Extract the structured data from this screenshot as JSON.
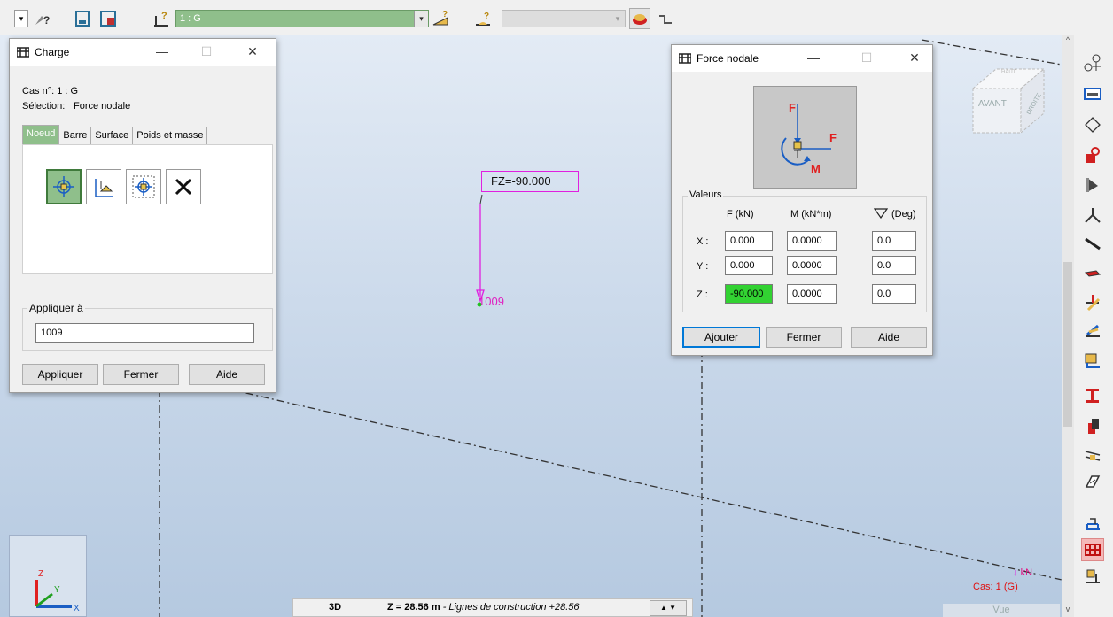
{
  "toolbar": {
    "case_combo": "1 : G",
    "view_combo": ""
  },
  "viewport": {
    "force_label": "FZ=-90.000",
    "node_label": "1009",
    "view_cube": {
      "front": "AVANT",
      "right": "DROITE",
      "top": "HAUT"
    },
    "status": {
      "mode": "3D",
      "z_value": "Z = 28.56 m",
      "z_desc": "- Lignes de construction +28.56"
    },
    "legend": {
      "unit": "kN",
      "case": "Cas: 1 (G)"
    },
    "vue": "Vue"
  },
  "charge_dialog": {
    "title": "Charge",
    "case_line": "Cas n°: 1 : G",
    "selection_label": "Sélection:",
    "selection_value": "Force nodale",
    "tabs": [
      "Noeud",
      "Barre",
      "Surface",
      "Poids et masse"
    ],
    "apply_to_label": "Appliquer à",
    "apply_to_value": "1009",
    "buttons": {
      "apply": "Appliquer",
      "close": "Fermer",
      "help": "Aide"
    }
  },
  "force_dialog": {
    "title": "Force nodale",
    "values_label": "Valeurs",
    "col_f": "F (kN)",
    "col_m": "M (kN*m)",
    "col_deg": "(Deg)",
    "rows": [
      {
        "label": "X :",
        "f": "0.000",
        "m": "0.0000",
        "deg": "0.0"
      },
      {
        "label": "Y :",
        "f": "0.000",
        "m": "0.0000",
        "deg": "0.0"
      },
      {
        "label": "Z :",
        "f": "-90.000",
        "m": "0.0000",
        "deg": "0.0"
      }
    ],
    "buttons": {
      "add": "Ajouter",
      "close": "Fermer",
      "help": "Aide"
    }
  },
  "colors": {
    "accent_green": "#8fbf8b",
    "magenta": "#e020e0",
    "active_field": "#32d232"
  }
}
